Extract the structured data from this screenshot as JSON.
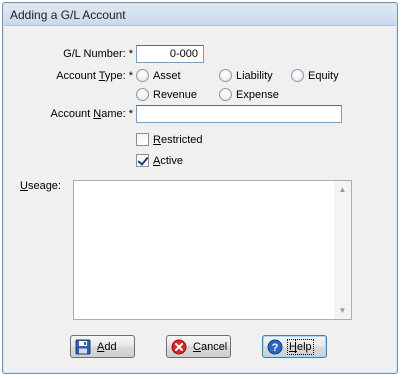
{
  "window": {
    "title": "Adding a G/L Account"
  },
  "form": {
    "gl_number": {
      "label": "G/L Number:",
      "required_mark": "*",
      "value": "0-000"
    },
    "account_type": {
      "label_before": "Account ",
      "label_accel": "T",
      "label_after": "ype:",
      "required_mark": "*",
      "options": [
        "Asset",
        "Liability",
        "Equity",
        "Revenue",
        "Expense"
      ]
    },
    "account_name": {
      "label_before": "Account ",
      "label_accel": "N",
      "label_after": "ame:",
      "required_mark": "*",
      "value": ""
    },
    "restricted": {
      "label_accel": "R",
      "label_rest": "estricted",
      "checked": false
    },
    "active": {
      "label_accel": "A",
      "label_rest": "ctive",
      "checked": true
    },
    "useage": {
      "label_accel": "U",
      "label_rest": "seage:",
      "value": ""
    }
  },
  "buttons": {
    "add": {
      "accel": "A",
      "rest": "dd"
    },
    "cancel": {
      "accel": "C",
      "rest": "ancel"
    },
    "help": {
      "accel": "H",
      "rest": "elp"
    }
  },
  "icons": {
    "add": "save-disk-icon",
    "cancel": "cancel-x-icon",
    "help": "help-question-icon",
    "scroll_up": "scroll-up-arrow-icon",
    "scroll_down": "scroll-down-arrow-icon"
  }
}
